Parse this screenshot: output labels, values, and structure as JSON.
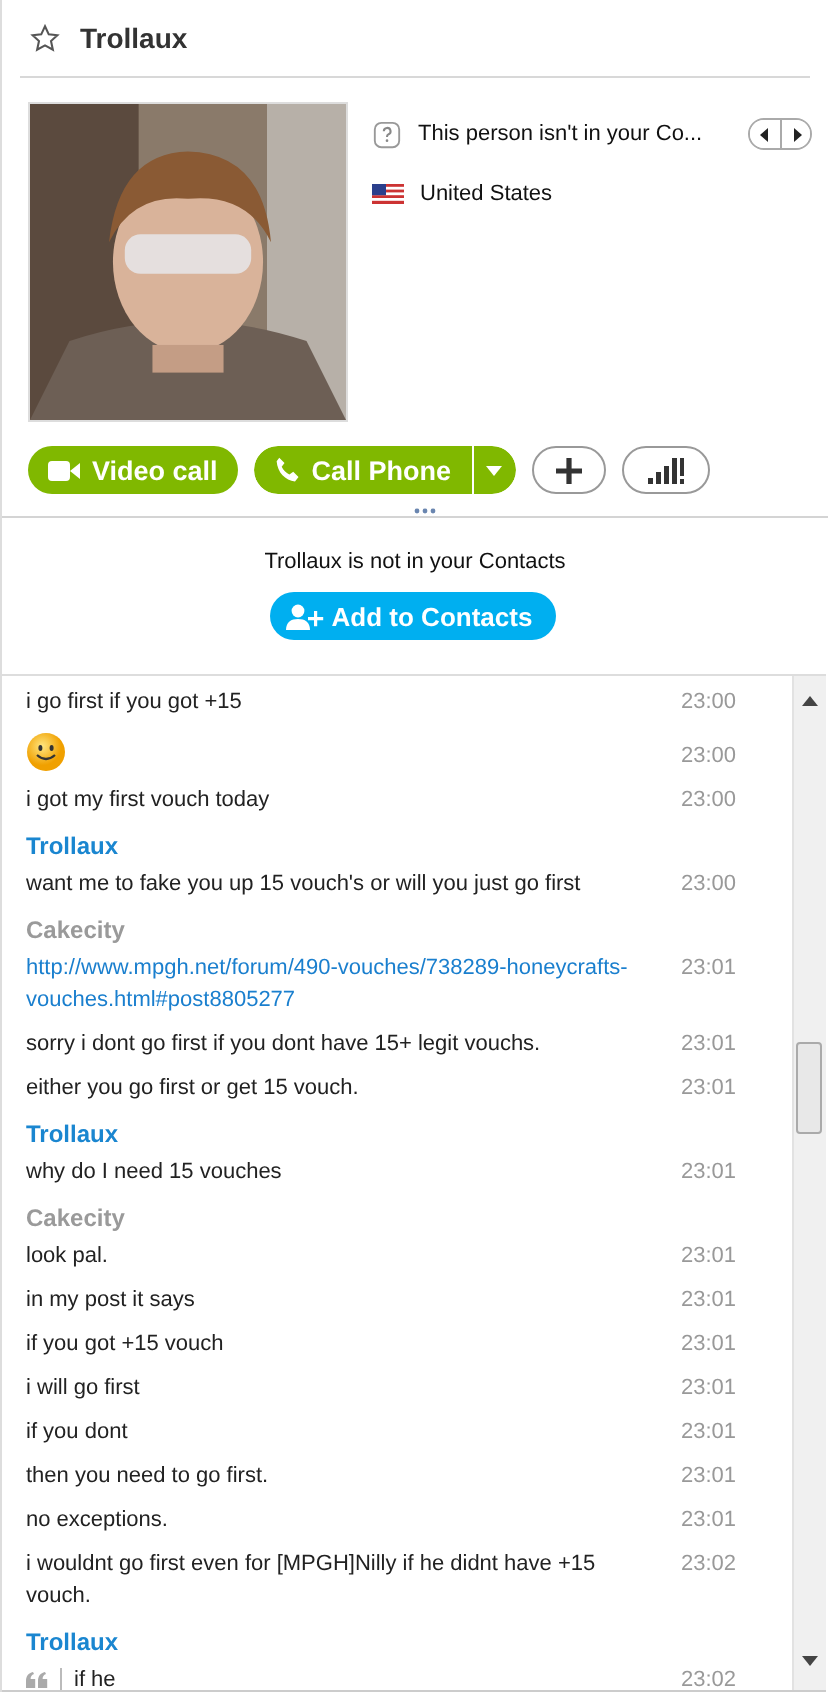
{
  "contact": {
    "name": "Trollaux",
    "favorite": false
  },
  "profile": {
    "status_note": "This person isn't in your Co...",
    "location": "United States"
  },
  "actions": [
    {
      "kind": "video",
      "label": "Video call"
    },
    {
      "kind": "phone",
      "label": "Call Phone"
    },
    {
      "kind": "add"
    },
    {
      "kind": "signal"
    }
  ],
  "notice": {
    "text": "Trollaux is not in your Contacts",
    "button": "Add to Contacts"
  },
  "chat": [
    {
      "kind": "text",
      "text": "i go first if you got +15",
      "time": "23:00"
    },
    {
      "kind": "emoji",
      "time": "23:00"
    },
    {
      "kind": "text",
      "text": "i got my first vouch today",
      "time": "23:00"
    },
    {
      "kind": "sender",
      "name": "Trollaux",
      "color": "#1a86d0"
    },
    {
      "kind": "text",
      "text": "want me to fake you up 15 vouch's or will you just go first",
      "time": "23:00"
    },
    {
      "kind": "sender",
      "name": "Cakecity",
      "color": "#9a9a9a"
    },
    {
      "kind": "link",
      "text": "http://www.mpgh.net/forum/490-vouches/738289-honeycrafts-vouches.html#post8805277",
      "time": "23:01"
    },
    {
      "kind": "text",
      "text": "sorry i dont go first if you dont have 15+ legit vouchs.",
      "time": "23:01"
    },
    {
      "kind": "text",
      "text": "either you go first or get 15 vouch.",
      "time": "23:01"
    },
    {
      "kind": "sender",
      "name": "Trollaux",
      "color": "#1a86d0"
    },
    {
      "kind": "text",
      "text": "why do I need 15 vouches",
      "time": "23:01"
    },
    {
      "kind": "sender",
      "name": "Cakecity",
      "color": "#9a9a9a"
    },
    {
      "kind": "text",
      "text": "look pal.",
      "time": "23:01"
    },
    {
      "kind": "text",
      "text": "in my post it says",
      "time": "23:01"
    },
    {
      "kind": "text",
      "text": "if you got +15 vouch",
      "time": "23:01"
    },
    {
      "kind": "text",
      "text": "i will go first",
      "time": "23:01"
    },
    {
      "kind": "text",
      "text": "if you dont",
      "time": "23:01"
    },
    {
      "kind": "text",
      "text": "then you need to go first.",
      "time": "23:01"
    },
    {
      "kind": "text",
      "text": "no exceptions.",
      "time": "23:01"
    },
    {
      "kind": "text",
      "text": "i wouldnt go first even for [MPGH]Nilly if he didnt have +15 vouch.",
      "time": "23:02"
    },
    {
      "kind": "sender",
      "name": "Trollaux",
      "color": "#1a86d0"
    },
    {
      "kind": "quote",
      "text": "if he",
      "time": "23:02"
    }
  ]
}
